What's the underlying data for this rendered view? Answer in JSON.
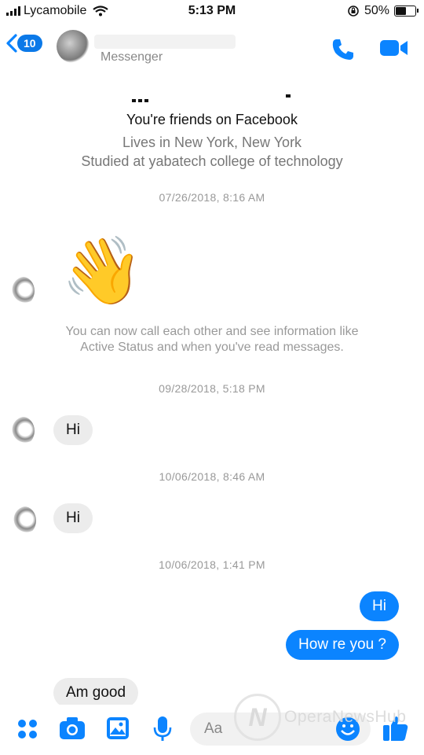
{
  "status_bar": {
    "carrier": "Lycamobile",
    "time": "5:13 PM",
    "battery_pct": "50%",
    "battery_level": 0.5
  },
  "header": {
    "back_badge": "10",
    "subtitle": "Messenger"
  },
  "intro": {
    "friends": "You're friends on Facebook",
    "lives": "Lives in New York, New York",
    "studied": "Studied at yabatech college of technology"
  },
  "timestamps": [
    "07/26/2018, 8:16 AM",
    "09/28/2018, 5:18 PM",
    "10/06/2018, 8:46 AM",
    "10/06/2018, 1:41 PM"
  ],
  "wave": {
    "emoji": "👋"
  },
  "info_text": {
    "line1": "You can now call each other and see information like",
    "line2": "Active Status and when you've read messages."
  },
  "messages": [
    {
      "from": "them",
      "text": "Hi"
    },
    {
      "from": "them",
      "text": "Hi"
    },
    {
      "from": "me",
      "text": "Hi"
    },
    {
      "from": "me",
      "text": "How re you ?"
    },
    {
      "from": "them",
      "text": "Am good"
    }
  ],
  "composer": {
    "placeholder": "Aa"
  },
  "watermark": {
    "text": "OperaNewsHub"
  },
  "icons": [
    "back-chevron-icon",
    "phone-icon",
    "video-camera-icon",
    "apps-grid-icon",
    "camera-icon",
    "gallery-icon",
    "microphone-icon",
    "emoji-icon",
    "like-icon"
  ],
  "colors": {
    "accent": "#0b84ff",
    "incoming_bubble": "#ececec",
    "meta_text": "#999999"
  }
}
